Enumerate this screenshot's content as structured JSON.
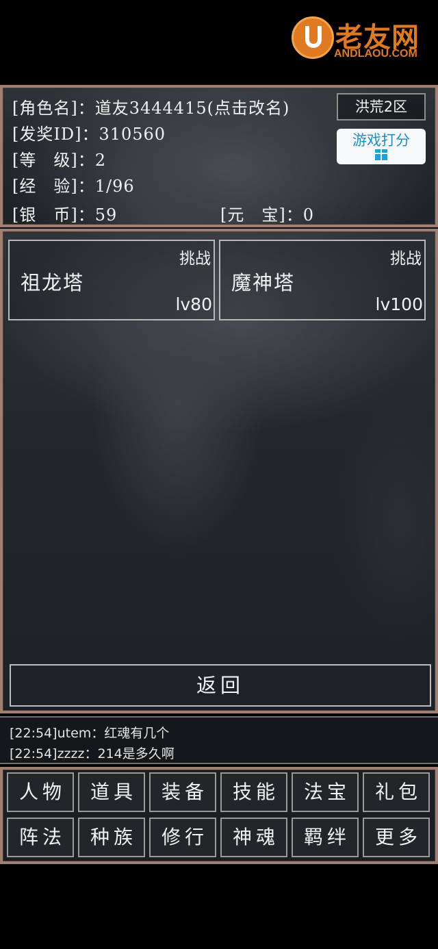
{
  "watermark": {
    "cn": "老友网",
    "en": "ANDLAOU.COM"
  },
  "player": {
    "name_row": "[角色名]：道友3444415(点击改名)",
    "id_row": "[发奖ID]：310560",
    "level_row": "[等　级]：2",
    "exp_row": "[经　验]：1/96",
    "silver_row": "[银　币]：59",
    "gold_row": "[元　宝]：0"
  },
  "zone_label": "洪荒2区",
  "rate_label": "游戏打分",
  "towers": [
    {
      "name": "祖龙塔",
      "challenge": "挑战",
      "level": "lv80"
    },
    {
      "name": "魔神塔",
      "challenge": "挑战",
      "level": "lv100"
    }
  ],
  "back_label": "返回",
  "chat": [
    "[22:54]utem：红魂有几个",
    "[22:54]zzzz：214是多久啊"
  ],
  "menu": [
    [
      "人物",
      "道具",
      "装备",
      "技能",
      "法宝",
      "礼包"
    ],
    [
      "阵法",
      "种族",
      "修行",
      "神魂",
      "羁绊",
      "更多"
    ]
  ],
  "colors": {
    "frame": "#9e7f72",
    "rate_text": "#1b8fc7",
    "watermark": "#e07a22"
  }
}
